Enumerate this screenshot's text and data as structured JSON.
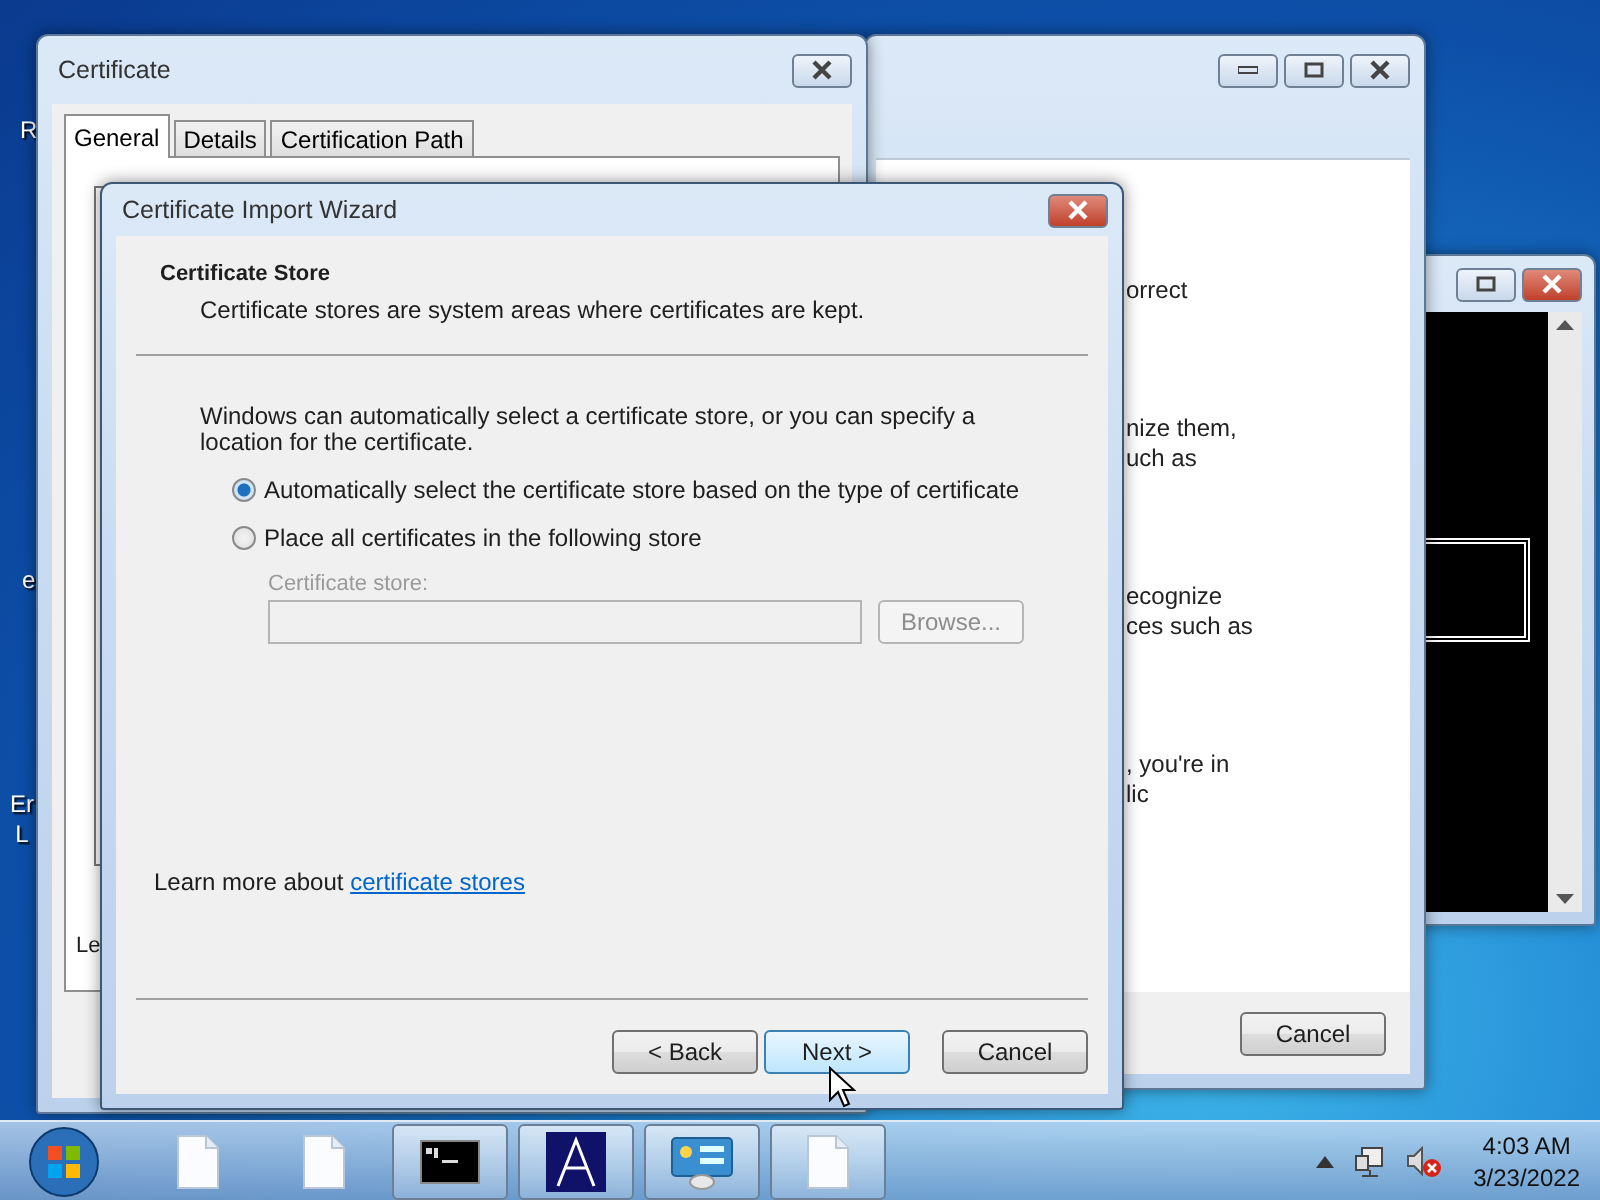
{
  "desktop": {
    "icon_labels": [
      {
        "text": "R",
        "kind": "top"
      },
      {
        "text": "e",
        "kind": "middle"
      },
      {
        "text": "Er\nL",
        "kind": "bottom"
      }
    ]
  },
  "console_window": {
    "kind": "console"
  },
  "background_window": {
    "text_fragments": [
      "orrect",
      "nize them,\nuch as",
      "ecognize\nces such as",
      ", you're in\nlic"
    ],
    "cancel_button": "Cancel"
  },
  "certificate_window": {
    "title": "Certificate",
    "tabs": [
      {
        "label": "General",
        "selected": true
      },
      {
        "label": "Details",
        "selected": false
      },
      {
        "label": "Certification Path",
        "selected": false
      }
    ],
    "content_fragment": "Le"
  },
  "wizard": {
    "title": "Certificate Import Wizard",
    "section_title": "Certificate Store",
    "section_subtitle": "Certificate stores are system areas where certificates are kept.",
    "intro": "Windows can automatically select a certificate store, or you can specify a location for the certificate.",
    "options": [
      {
        "label": "Automatically select the certificate store based on the type of certificate",
        "selected": true
      },
      {
        "label": "Place all certificates in the following store",
        "selected": false
      }
    ],
    "store_disabled": true,
    "store_label": "Certificate store:",
    "browse_button": "Browse...",
    "learn_more_prefix": "Learn more about",
    "learn_more_link": "certificate stores",
    "buttons": [
      {
        "label": "< Back",
        "focused": false
      },
      {
        "label": "Next >",
        "focused": true
      },
      {
        "label": "Cancel",
        "focused": false
      }
    ]
  },
  "taskbar": {
    "items": [
      {
        "kind": "document",
        "running": false
      },
      {
        "kind": "document",
        "running": false
      },
      {
        "kind": "console",
        "running": true
      },
      {
        "kind": "triangle-app",
        "running": true
      },
      {
        "kind": "control-panel",
        "running": true
      },
      {
        "kind": "document",
        "running": true
      }
    ],
    "clock": {
      "time": "4:03 AM",
      "date": "3/23/2022"
    }
  }
}
